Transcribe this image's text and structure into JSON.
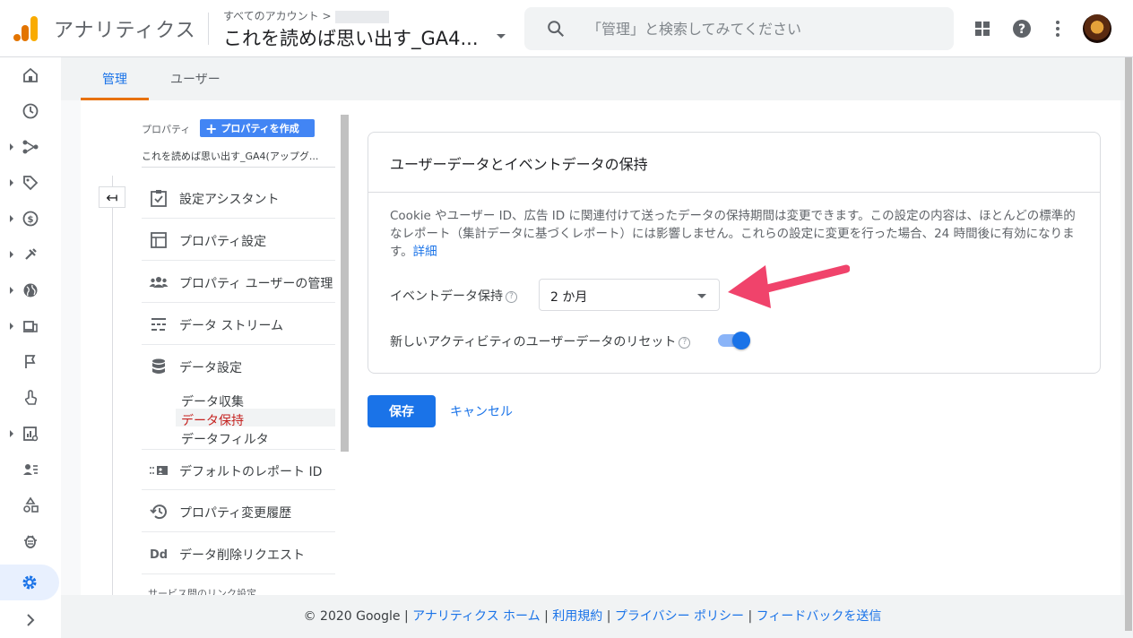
{
  "header": {
    "app_name": "アナリティクス",
    "account_path": "すべてのアカウント >",
    "account_name": "これを読めば思い出す_GA4...",
    "search_placeholder": "「管理」と検索してみてください"
  },
  "tabs": [
    {
      "label": "管理",
      "active": true
    },
    {
      "label": "ユーザー",
      "active": false
    }
  ],
  "property": {
    "label": "プロパティ",
    "create_label": "プロパティを作成",
    "name": "これを読めば思い出す_GA4(アップグ...",
    "back_glyph": "↤"
  },
  "menu": [
    {
      "label": "設定アシスタント",
      "icon": "checklist-icon"
    },
    {
      "label": "プロパティ設定",
      "icon": "property-settings-icon"
    },
    {
      "label": "プロパティ ユーザーの管理",
      "icon": "users-icon"
    },
    {
      "label": "データ ストリーム",
      "icon": "stream-icon"
    },
    {
      "label": "データ設定",
      "icon": "database-icon"
    },
    {
      "label": "デフォルトのレポート ID",
      "icon": "id-card-icon"
    },
    {
      "label": "プロパティ変更履歴",
      "icon": "history-icon"
    },
    {
      "label": "データ削除リクエスト",
      "icon": "dd-icon"
    }
  ],
  "submenu": [
    {
      "label": "データ収集"
    },
    {
      "label": "データ保持",
      "active": true
    },
    {
      "label": "データフィルタ"
    }
  ],
  "next_section": "サービス間のリンク設定",
  "card": {
    "title": "ユーザーデータとイベントデータの保持",
    "description": "Cookie やユーザー ID、広告 ID に関連付けて送ったデータの保持期間は変更できます。この設定の内容は、ほとんどの標準的なレポート（集計データに基づくレポート）には影響しません。これらの設定に変更を行った場合、24 時間後に有効になります。",
    "details_link": "詳細",
    "event_retention_label": "イベントデータ保持",
    "event_retention_value": "2 か月",
    "reset_label": "新しいアクティビティのユーザーデータのリセット",
    "reset_enabled": true
  },
  "actions": {
    "save": "保存",
    "cancel": "キャンセル"
  },
  "footer": {
    "copyright": "© 2020 Google",
    "links": [
      "アナリティクス ホーム",
      "利用規約",
      "プライバシー ポリシー",
      "フィードバックを送信"
    ]
  },
  "colors": {
    "accent": "#1a73e8",
    "tab_underline": "#e8710a",
    "arrow": "#f0436b"
  }
}
